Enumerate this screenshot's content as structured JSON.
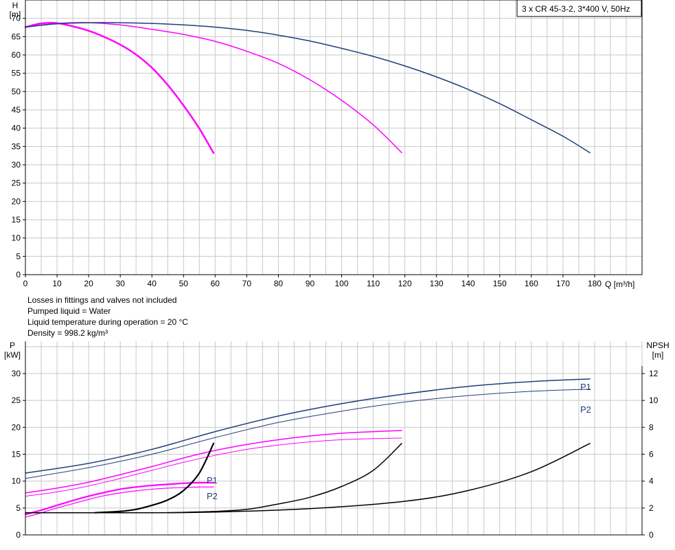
{
  "chart_data": [
    {
      "type": "line",
      "title": "3 x CR 45-3-2, 3*400 V, 50Hz",
      "ylabel": "H",
      "yunit": "[m]",
      "xlabel": "Q [m³/h]",
      "xlim": [
        0,
        195
      ],
      "ylim": [
        0,
        75
      ],
      "xticks": [
        0,
        10,
        20,
        30,
        40,
        50,
        60,
        70,
        80,
        90,
        100,
        110,
        120,
        130,
        140,
        150,
        160,
        170,
        180
      ],
      "yticks": [
        0,
        5,
        10,
        15,
        20,
        25,
        30,
        35,
        40,
        45,
        50,
        55,
        60,
        65,
        70
      ],
      "grid": true,
      "series": [
        {
          "color": "#ff00ff",
          "width": 2.5,
          "x": [
            0,
            5,
            10,
            15,
            20,
            25,
            30,
            35,
            40,
            45,
            50,
            55,
            59.5
          ],
          "y": [
            67.6,
            68.6,
            68.7,
            67.8,
            66.6,
            64.9,
            62.8,
            60.1,
            56.5,
            51.8,
            46.2,
            39.9,
            33.2
          ]
        },
        {
          "color": "#ff00ff",
          "width": 1.5,
          "x": [
            0,
            10,
            20,
            30,
            40,
            50,
            60,
            70,
            80,
            90,
            100,
            110,
            119
          ],
          "y": [
            67.6,
            68.6,
            68.8,
            68.2,
            67.0,
            65.6,
            63.7,
            61.0,
            57.7,
            53.2,
            47.6,
            40.9,
            33.3
          ]
        },
        {
          "color": "#1f3d7a",
          "width": 1.5,
          "x": [
            0,
            10,
            20,
            30,
            40,
            50,
            60,
            70,
            80,
            90,
            100,
            110,
            120,
            130,
            140,
            150,
            160,
            170,
            178.5
          ],
          "y": [
            67.6,
            68.5,
            68.8,
            68.8,
            68.6,
            68.2,
            67.6,
            66.7,
            65.4,
            63.8,
            61.8,
            59.6,
            57.0,
            54.0,
            50.6,
            46.7,
            42.3,
            37.8,
            33.3
          ]
        }
      ]
    },
    {
      "type": "line",
      "ylabel": "P",
      "yunit": "[kW]",
      "y2label": "NPSH",
      "y2unit": "[m]",
      "xlim": [
        0,
        195
      ],
      "ylim": [
        0,
        36
      ],
      "y2lim": [
        0,
        14.4
      ],
      "yticks": [
        0,
        5,
        10,
        15,
        20,
        25,
        30
      ],
      "y2ticks": [
        0,
        2,
        4,
        6,
        8,
        10,
        12
      ],
      "grid": true,
      "labels": {
        "p1_top": "P1",
        "p2_top": "P2",
        "p1_low": "P1",
        "p2_low": "P2"
      },
      "series": [
        {
          "color": "#1f3d7a",
          "width": 1.5,
          "axis": "P",
          "x": [
            0,
            20,
            40,
            60,
            80,
            100,
            120,
            140,
            160,
            178.5
          ],
          "y": [
            11.5,
            13.3,
            15.9,
            19.2,
            22.1,
            24.4,
            26.2,
            27.6,
            28.5,
            29.0
          ]
        },
        {
          "color": "#1f3d7a",
          "width": 1.0,
          "axis": "P",
          "x": [
            0,
            20,
            40,
            60,
            80,
            100,
            120,
            140,
            160,
            178.5
          ],
          "y": [
            10.5,
            12.5,
            15.0,
            18.1,
            20.9,
            23.0,
            24.7,
            25.9,
            26.7,
            27.1
          ]
        },
        {
          "color": "#ff00ff",
          "width": 1.5,
          "axis": "P",
          "x": [
            0,
            10,
            20,
            30,
            40,
            50,
            60,
            70,
            80,
            90,
            100,
            110,
            119
          ],
          "y": [
            7.8,
            8.7,
            9.8,
            11.2,
            12.7,
            14.3,
            15.7,
            16.8,
            17.7,
            18.4,
            18.9,
            19.2,
            19.4
          ]
        },
        {
          "color": "#ff00ff",
          "width": 1.0,
          "axis": "P",
          "x": [
            0,
            10,
            20,
            30,
            40,
            50,
            60,
            70,
            80,
            90,
            100,
            110,
            119
          ],
          "y": [
            7.2,
            8.0,
            9.1,
            10.5,
            12.0,
            13.5,
            14.8,
            15.9,
            16.7,
            17.3,
            17.7,
            17.9,
            18.0
          ]
        },
        {
          "color": "#ff00ff",
          "width": 2.2,
          "axis": "P",
          "x": [
            0,
            5,
            10,
            15,
            20,
            25,
            30,
            35,
            40,
            45,
            50,
            55,
            59.5
          ],
          "y": [
            3.8,
            4.6,
            5.5,
            6.4,
            7.2,
            7.9,
            8.5,
            8.9,
            9.2,
            9.4,
            9.6,
            9.7,
            9.7
          ]
        },
        {
          "color": "#ff00ff",
          "width": 1.2,
          "axis": "P",
          "x": [
            0,
            5,
            10,
            15,
            20,
            25,
            30,
            35,
            40,
            45,
            50,
            55,
            59.5
          ],
          "y": [
            3.3,
            4.1,
            5.0,
            5.8,
            6.6,
            7.3,
            7.8,
            8.2,
            8.5,
            8.7,
            8.8,
            8.9,
            8.9
          ]
        },
        {
          "color": "#000000",
          "width": 2.2,
          "axis": "NPSH",
          "x": [
            22,
            30,
            35,
            40,
            45,
            50,
            55,
            59.5
          ],
          "y": [
            1.65,
            1.75,
            1.9,
            2.2,
            2.6,
            3.3,
            4.6,
            6.8
          ]
        },
        {
          "color": "#000000",
          "width": 1.5,
          "axis": "NPSH",
          "x": [
            45,
            60,
            70,
            80,
            90,
            100,
            110,
            119
          ],
          "y": [
            1.65,
            1.75,
            1.9,
            2.3,
            2.8,
            3.6,
            4.8,
            6.8
          ]
        },
        {
          "color": "#000000",
          "width": 1.5,
          "axis": "NPSH",
          "x": [
            0,
            40,
            60,
            90,
            120,
            140,
            160,
            178.5
          ],
          "y": [
            1.65,
            1.65,
            1.7,
            1.95,
            2.5,
            3.3,
            4.7,
            6.8
          ]
        }
      ]
    }
  ],
  "notes": {
    "line1": "Losses in fittings and valves not included",
    "line2": "Pumped liquid = Water",
    "line3": "Liquid temperature during operation = 20 °C",
    "line4": "Density = 998.2 kg/m³"
  }
}
